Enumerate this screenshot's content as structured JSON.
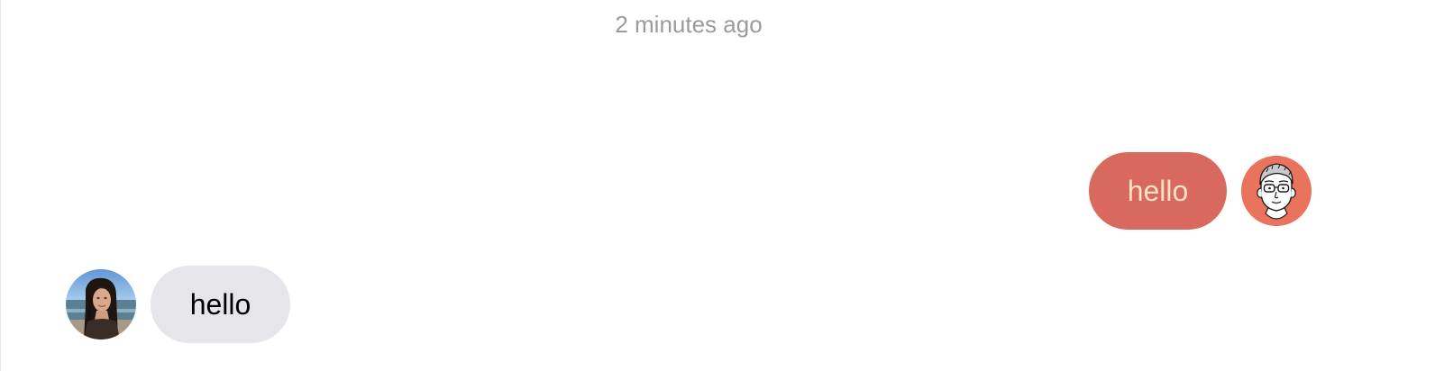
{
  "conversation": {
    "timestamp": "2 minutes ago",
    "messages": [
      {
        "direction": "outgoing",
        "text": "hello",
        "avatar_icon": "cartoon-face-glasses-icon",
        "bubble_color": "#d9685e",
        "text_color": "#fde3c6",
        "avatar_color": "#e9735c"
      },
      {
        "direction": "incoming",
        "text": "hello",
        "avatar_icon": "profile-photo-icon",
        "bubble_color": "#e6e5ea",
        "text_color": "#000000"
      }
    ]
  },
  "colors": {
    "timestamp": "#9b9b9b",
    "background": "#ffffff"
  }
}
